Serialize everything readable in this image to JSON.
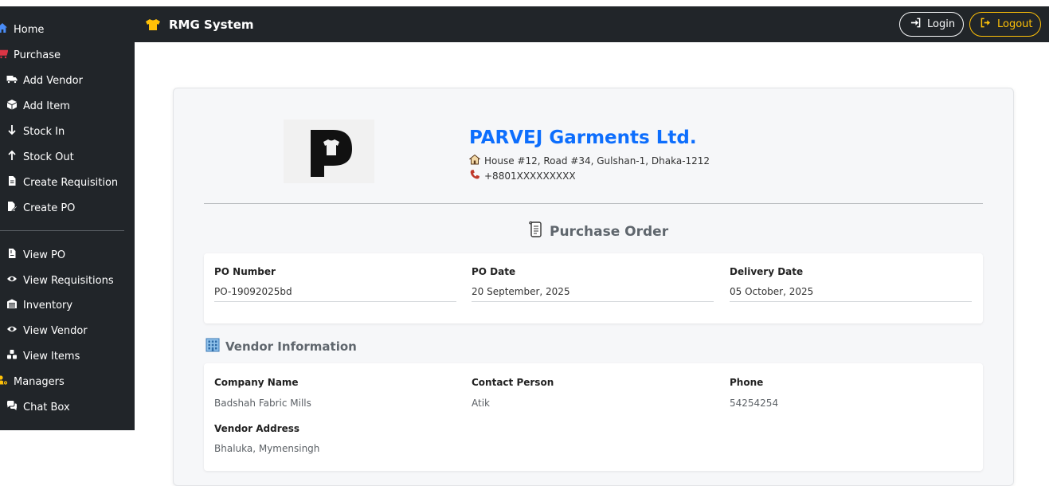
{
  "topbar": {
    "brand": "RMG System",
    "login_label": "Login",
    "logout_label": "Logout"
  },
  "sidebar": {
    "items": [
      {
        "label": "Home",
        "icon": "home-icon"
      },
      {
        "label": "Purchase",
        "icon": "cart-icon"
      },
      {
        "label": "Add Vendor",
        "icon": "truck-icon"
      },
      {
        "label": "Add Item",
        "icon": "box-icon"
      },
      {
        "label": "Stock In",
        "icon": "arrow-down-icon"
      },
      {
        "label": "Stock Out",
        "icon": "arrow-up-icon"
      },
      {
        "label": "Create Requisition",
        "icon": "file-icon"
      },
      {
        "label": "Create PO",
        "icon": "file-edit-icon"
      },
      {
        "label": "View PO",
        "icon": "file-invoice-icon"
      },
      {
        "label": "View Requisitions",
        "icon": "eye-icon"
      },
      {
        "label": "Inventory",
        "icon": "warehouse-icon"
      },
      {
        "label": "View Vendor",
        "icon": "eye-icon"
      },
      {
        "label": "View Items",
        "icon": "cubes-icon"
      },
      {
        "label": "Managers",
        "icon": "users-cog-icon"
      },
      {
        "label": "Chat Box",
        "icon": "comments-icon"
      }
    ]
  },
  "company": {
    "name": "PARVEJ Garments Ltd.",
    "address": "House #12, Road #34, Gulshan-1, Dhaka-1212",
    "phone": "+8801XXXXXXXXX"
  },
  "po": {
    "title": "Purchase Order",
    "number_label": "PO Number",
    "number": "PO-19092025bd",
    "date_label": "PO Date",
    "date": "20 September, 2025",
    "delivery_label": "Delivery Date",
    "delivery": "05 October, 2025"
  },
  "vendor": {
    "heading": "Vendor Information",
    "company_label": "Company Name",
    "company": "Badshah Fabric Mills",
    "contact_label": "Contact Person",
    "contact": "Atik",
    "phone_label": "Phone",
    "phone": "54254254",
    "address_label": "Vendor Address",
    "address": "Bhaluka, Mymensingh"
  },
  "colors": {
    "dark": "#212529",
    "brand_blue": "#0d6efd",
    "warning": "#ffc107"
  }
}
